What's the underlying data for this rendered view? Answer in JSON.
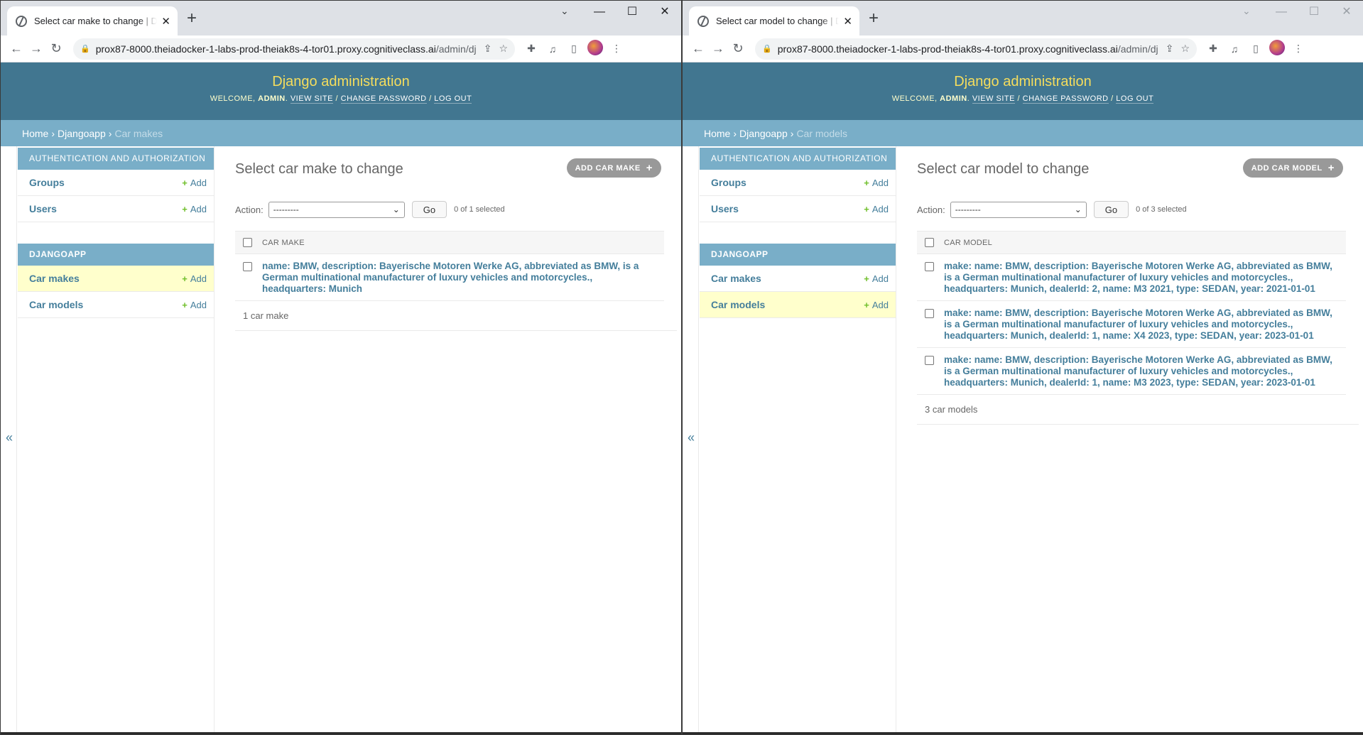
{
  "left": {
    "tab_title": "Select car make to change | Django site admin",
    "url_main": "prox87-8000.theiadocker-1-labs-prod-theiak8s-4-tor01.proxy.cognitiveclass.ai",
    "url_path": "/admin/djan...",
    "site_title": "Django administration",
    "welcome": "Welcome,",
    "user": "admin",
    "view_site": "View site",
    "change_password": "Change password",
    "log_out": "Log out",
    "bc_home": "Home",
    "bc_app": "Djangoapp",
    "bc_current": "Car makes",
    "auth_caption": "Authentication and Authorization",
    "groups": "Groups",
    "users": "Users",
    "add": "Add",
    "app_caption": "Djangoapp",
    "car_makes": "Car makes",
    "car_models": "Car models",
    "page_title": "Select car make to change",
    "add_button": "Add car make",
    "action_label": "Action:",
    "action_value": "---------",
    "go": "Go",
    "selected": "0 of 1 selected",
    "column": "Car make",
    "rows": [
      "name: BMW, description: Bayerische Motoren Werke AG, abbreviated as BMW, is a German multinational manufacturer of luxury vehicles and motorcycles., headquarters: Munich"
    ],
    "count": "1 car make"
  },
  "right": {
    "tab_title": "Select car model to change | Django site admin",
    "url_main": "prox87-8000.theiadocker-1-labs-prod-theiak8s-4-tor01.proxy.cognitiveclass.ai",
    "url_path": "/admin/djan...",
    "site_title": "Django administration",
    "welcome": "Welcome,",
    "user": "admin",
    "view_site": "View site",
    "change_password": "Change password",
    "log_out": "Log out",
    "bc_home": "Home",
    "bc_app": "Djangoapp",
    "bc_current": "Car models",
    "auth_caption": "Authentication and Authorization",
    "groups": "Groups",
    "users": "Users",
    "add": "Add",
    "app_caption": "Djangoapp",
    "car_makes": "Car makes",
    "car_models": "Car models",
    "page_title": "Select car model to change",
    "add_button": "Add car model",
    "action_label": "Action:",
    "action_value": "---------",
    "go": "Go",
    "selected": "0 of 3 selected",
    "column": "Car model",
    "rows": [
      "make: name: BMW, description: Bayerische Motoren Werke AG, abbreviated as BMW, is a German multinational manufacturer of luxury vehicles and motorcycles., headquarters: Munich, dealerId: 2, name: M3 2021, type: SEDAN, year: 2021-01-01",
      "make: name: BMW, description: Bayerische Motoren Werke AG, abbreviated as BMW, is a German multinational manufacturer of luxury vehicles and motorcycles., headquarters: Munich, dealerId: 1, name: X4 2023, type: SEDAN, year: 2023-01-01",
      "make: name: BMW, description: Bayerische Motoren Werke AG, abbreviated as BMW, is a German multinational manufacturer of luxury vehicles and motorcycles., headquarters: Munich, dealerId: 1, name: M3 2023, type: SEDAN, year: 2023-01-01"
    ],
    "count": "3 car models"
  },
  "icons": {
    "favicon": "globe-icon",
    "close": "close-icon",
    "new_tab": "plus-icon",
    "back": "back-arrow-icon",
    "forward": "forward-arrow-icon",
    "reload": "reload-icon",
    "lock": "lock-icon",
    "share": "share-icon",
    "star": "star-icon",
    "extensions": "puzzle-icon",
    "media": "media-icon",
    "sidepanel": "side-panel-icon",
    "profile": "avatar",
    "menu": "kebab-menu-icon",
    "collapse": "double-chevron-left-icon"
  },
  "colors": {
    "header": "#417690",
    "breadcrumbs": "#79aec8",
    "title": "#f5dd5d",
    "link": "#447e9b",
    "current_row": "#ffffcc",
    "add_plus": "#70bf2b"
  }
}
